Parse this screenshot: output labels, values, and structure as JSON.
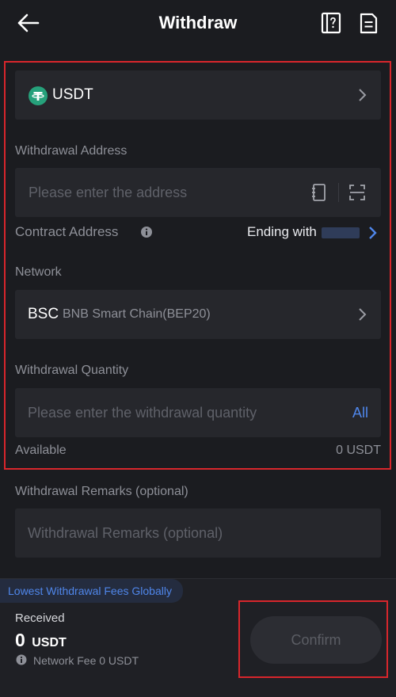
{
  "header": {
    "title": "Withdraw"
  },
  "coin": {
    "symbol": "USDT"
  },
  "address": {
    "label": "Withdrawal Address",
    "placeholder": "Please enter the address",
    "contract_label": "Contract Address",
    "contract_value": "Ending with"
  },
  "network": {
    "label": "Network",
    "code": "BSC",
    "name": "BNB Smart Chain(BEP20)"
  },
  "quantity": {
    "label": "Withdrawal Quantity",
    "placeholder": "Please enter the withdrawal quantity",
    "all": "All",
    "available_label": "Available",
    "available_value": "0 USDT"
  },
  "remarks": {
    "label": "Withdrawal Remarks (optional)",
    "placeholder": "Withdrawal Remarks (optional)"
  },
  "footer": {
    "promo": "Lowest Withdrawal Fees Globally",
    "received_label": "Received",
    "received_amount": "0",
    "received_unit": "USDT",
    "network_fee": "Network Fee 0 USDT",
    "confirm": "Confirm"
  },
  "colors": {
    "background": "#1b1c20",
    "field": "#26272c",
    "accent": "#4f86ea",
    "tether": "#26a17b",
    "highlight": "#d8262c"
  }
}
